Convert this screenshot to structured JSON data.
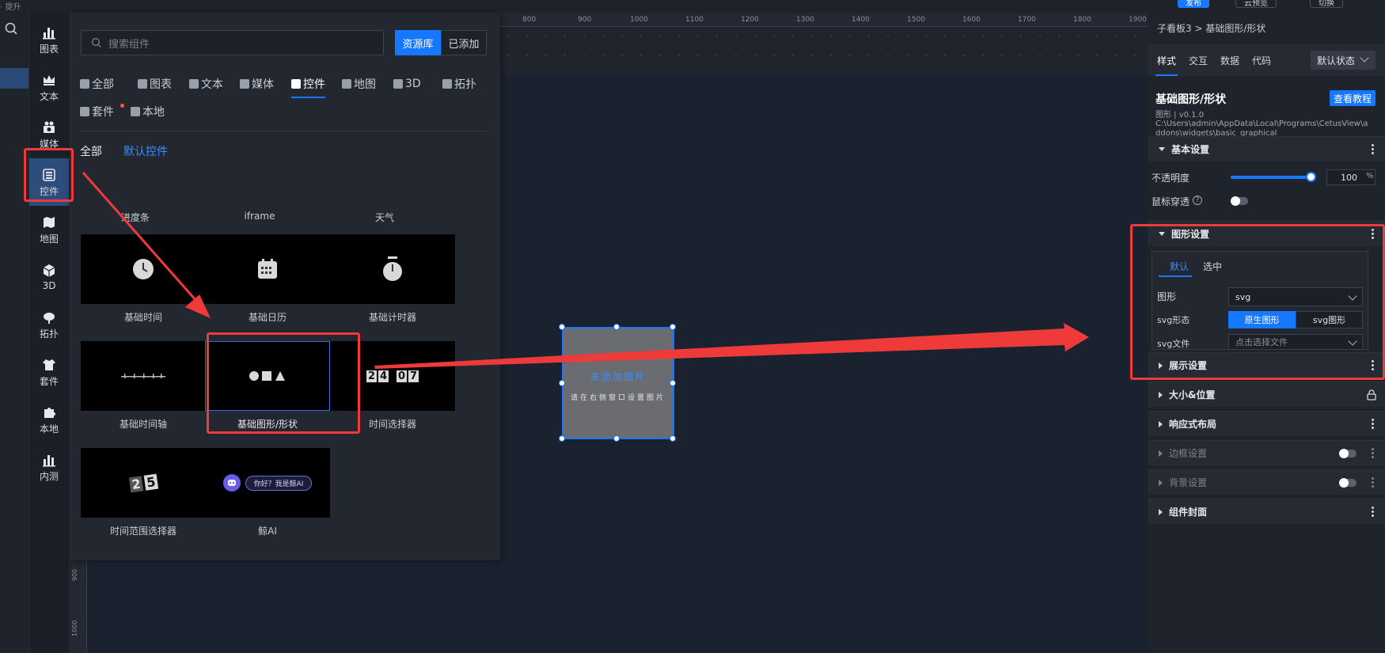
{
  "topbar": {
    "left_text": "· 提升",
    "publish_label": "发布",
    "preview_label": "云预览",
    "switch_label": "切换"
  },
  "categories": [
    {
      "label": "图表",
      "icon": "bar-chart-icon"
    },
    {
      "label": "文本",
      "icon": "text-icon"
    },
    {
      "label": "媒体",
      "icon": "media-icon"
    },
    {
      "label": "控件",
      "icon": "widget-control-icon"
    },
    {
      "label": "地图",
      "icon": "map-icon"
    },
    {
      "label": "3D",
      "icon": "cube-icon"
    },
    {
      "label": "拓扑",
      "icon": "topology-icon"
    },
    {
      "label": "套件",
      "icon": "kit-icon"
    },
    {
      "label": "本地",
      "icon": "puzzle-icon"
    },
    {
      "label": "内测",
      "icon": "beta-chart-icon"
    }
  ],
  "panel": {
    "search_placeholder": "搜索组件",
    "source_library": "资源库",
    "added": "已添加",
    "tabs": [
      "全部",
      "图表",
      "文本",
      "媒体",
      "控件",
      "地图",
      "3D",
      "拓扑",
      "套件",
      "本地"
    ],
    "active_tab": "控件",
    "subtabs": [
      "全部",
      "默认控件"
    ],
    "header_captions": [
      "进度条",
      "iframe",
      "天气"
    ],
    "items": [
      {
        "caption": "基础时间"
      },
      {
        "caption": "基础日历"
      },
      {
        "caption": "基础计时器"
      },
      {
        "caption": "基础时间轴"
      },
      {
        "caption": "基础图形/形状"
      },
      {
        "caption": "时间选择器"
      },
      {
        "caption": "时间范围选择器"
      },
      {
        "caption": "鲸AI",
        "bubble": "你好？我是鲸AI"
      }
    ],
    "digits": [
      "2",
      "4",
      "0",
      "7"
    ],
    "range_digits": [
      "2",
      "5"
    ]
  },
  "ruler": {
    "top": [
      "800",
      "900",
      "1000",
      "1100",
      "1200",
      "1300",
      "1400",
      "1500",
      "1600",
      "1700",
      "1800",
      "1900"
    ],
    "left": [
      "900",
      "1000"
    ]
  },
  "widget": {
    "title": "未添加图片",
    "hint": "请在右侧窗口设置图片"
  },
  "right_panel": {
    "breadcrumb": "子看板3 > 基础图形/形状",
    "tabs": [
      "样式",
      "交互",
      "数据",
      "代码"
    ],
    "state": "默认状态",
    "widget_title": "基础图形/形状",
    "tutorial": "查看教程",
    "version": "图形 | v0.1.0",
    "path_line1": "C:\\Users\\admin\\AppData\\Local\\Programs\\CetusView\\a",
    "path_line2": "ddons\\widgets\\basic_graphical",
    "basic_section": "基本设置",
    "opacity_label": "不透明度",
    "opacity_value": "100",
    "opacity_unit": "%",
    "passthrough_label": "鼠标穿透",
    "shape_section": "图形设置",
    "shape_tabs": [
      "默认",
      "选中"
    ],
    "shape_label": "图形",
    "shape_value": "svg",
    "svg_form_label": "svg形态",
    "svg_form_options": [
      "原生图形",
      "svg图形"
    ],
    "svg_file_label": "svg文件",
    "svg_file_placeholder": "点击选择文件",
    "sections": [
      "展示设置",
      "大小&位置",
      "响应式布局",
      "边框设置",
      "背景设置",
      "组件封面"
    ]
  },
  "colors": {
    "accent": "#1677ff",
    "highlight": "#ef3a3a"
  }
}
